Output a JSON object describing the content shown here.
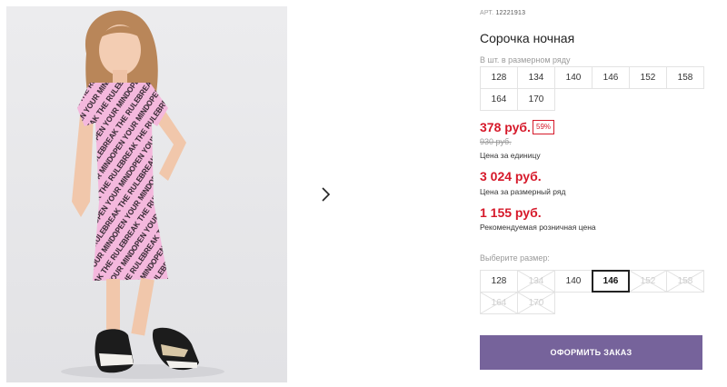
{
  "product": {
    "article_label": "АРТ.",
    "article_number": "12221913",
    "title": "Сорочка ночная",
    "pack_label": "В шт. в размерном ряду",
    "pack_sizes": [
      "128",
      "134",
      "140",
      "146",
      "152",
      "158",
      "164",
      "170"
    ],
    "price": "378 руб.",
    "discount": "59%",
    "old_price": "930 руб.",
    "price_caption": "Цена за единицу",
    "row_price": "3 024 руб.",
    "row_price_caption": "Цена за размерный ряд",
    "retail_price": "1 155 руб.",
    "retail_caption": "Рекомендуемая розничная цена",
    "choose_size_label": "Выберите размер:",
    "choose_sizes": [
      {
        "label": "128",
        "state": "available"
      },
      {
        "label": "134",
        "state": "unavailable"
      },
      {
        "label": "140",
        "state": "available"
      },
      {
        "label": "146",
        "state": "selected"
      },
      {
        "label": "152",
        "state": "unavailable"
      },
      {
        "label": "158",
        "state": "unavailable"
      },
      {
        "label": "164",
        "state": "unavailable"
      },
      {
        "label": "170",
        "state": "unavailable"
      }
    ],
    "order_button": "ОФОРМИТЬ ЗАКАЗ"
  },
  "gallery": {
    "next_icon": "chevron-right-icon",
    "dress_print_text": "OPEN YOUR MIND BREAK THE RULES"
  },
  "colors": {
    "price_red": "#d6192a",
    "button_purple": "#76639b",
    "dress_pink": "#f4b8dd"
  }
}
